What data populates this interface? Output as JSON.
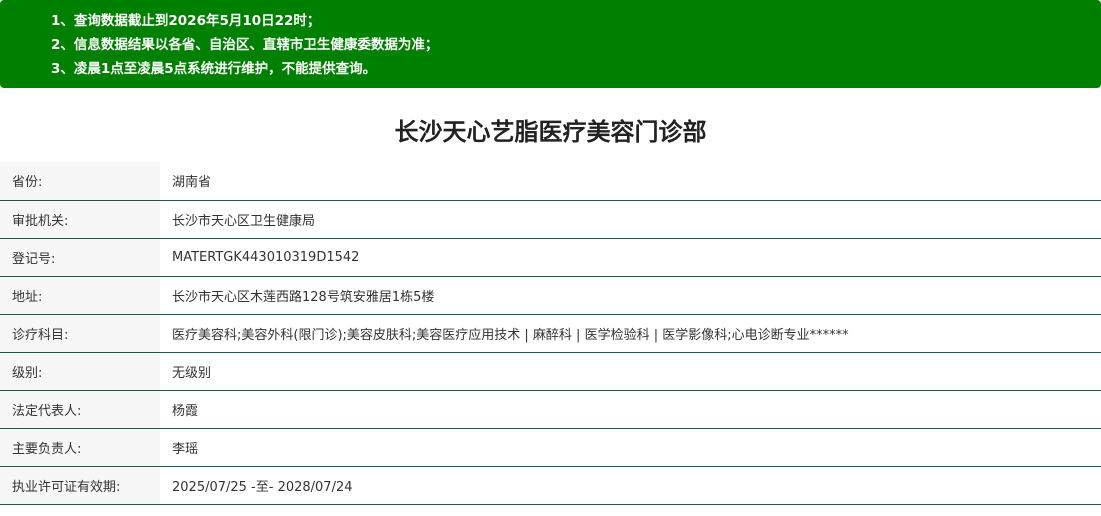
{
  "notice": {
    "lines": [
      "1、查询数据截止到2026年5月10日22时；",
      "2、信息数据结果以各省、自治区、直辖市卫生健康委数据为准；",
      "3、凌晨1点至凌晨5点系统进行维护，不能提供查询。"
    ],
    "background_color": "#008000",
    "text_color": "#ffffff"
  },
  "title": "长沙天心艺脂医疗美容门诊部",
  "details": [
    {
      "label": "省份:",
      "value": "湖南省"
    },
    {
      "label": "审批机关:",
      "value": "长沙市天心区卫生健康局"
    },
    {
      "label": "登记号:",
      "value": "MATERTGK443010319D1542"
    },
    {
      "label": "地址:",
      "value": "长沙市天心区木莲西路128号筑安雅居1栋5楼"
    },
    {
      "label": "诊疗科目:",
      "value": "医疗美容科;美容外科(限门诊);美容皮肤科;美容医疗应用技术 | 麻醉科 | 医学检验科 | 医学影像科;心电诊断专业******"
    },
    {
      "label": "级别:",
      "value": "无级别"
    },
    {
      "label": "法定代表人:",
      "value": "杨霞"
    },
    {
      "label": "主要负责人:",
      "value": "李瑶"
    },
    {
      "label": "执业许可证有效期:",
      "value": "2025/07/25 -至- 2028/07/24"
    }
  ],
  "colors": {
    "row_border": "#1a5c3a",
    "label_background": "#f7f7f7"
  }
}
